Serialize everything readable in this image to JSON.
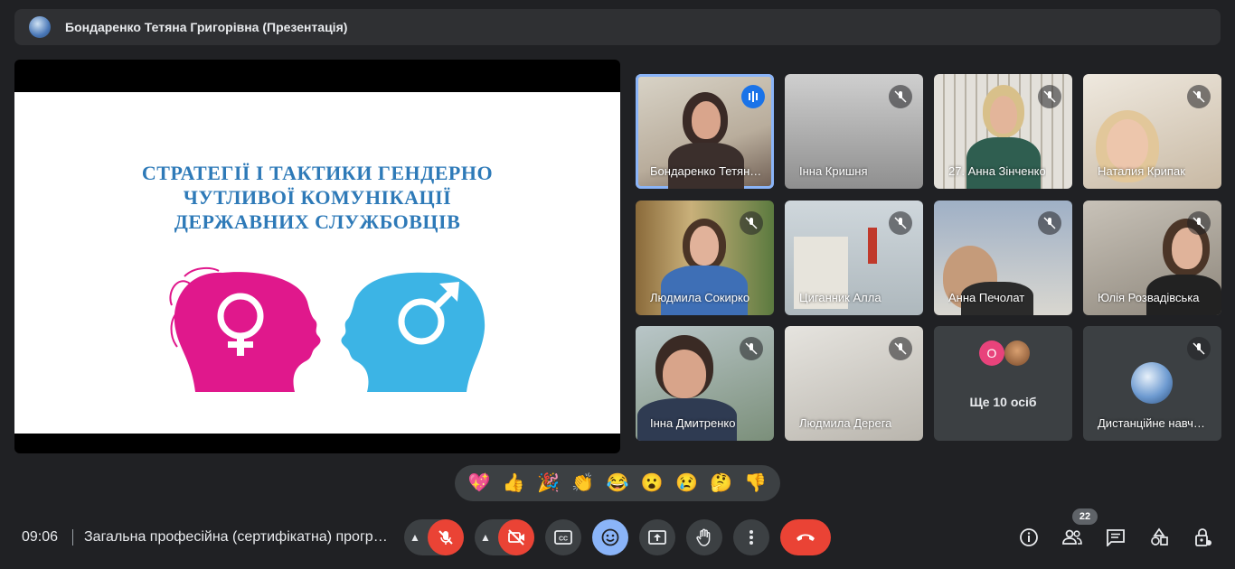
{
  "presentation": {
    "presenter_title": "Бондаренко Тетяна Григорівна (Презентація)",
    "slide": {
      "title_lines": [
        "СТРАТЕГІЇ І ТАКТИКИ ГЕНДЕРНО",
        "ЧУТЛИВОЇ КОМУНІКАЦІЇ",
        "ДЕРЖАВНИХ СЛУЖБОВЦІВ"
      ],
      "colors": {
        "title": "#2e7ab8",
        "female": "#e0188c",
        "male": "#3cb4e5"
      }
    }
  },
  "participants": [
    {
      "name": "Бондаренко Тетяна Григорівна",
      "speaking": true,
      "muted": false
    },
    {
      "name": "Інна Кришня",
      "muted": true
    },
    {
      "name": "27. Анна Зінченко",
      "muted": true
    },
    {
      "name": "Наталия Крипак",
      "muted": true
    },
    {
      "name": "Людмила Сокирко",
      "muted": true
    },
    {
      "name": "Циганник Алла",
      "muted": true
    },
    {
      "name": "Анна Печолат",
      "muted": true
    },
    {
      "name": "Юлія Розвадівська",
      "muted": true
    },
    {
      "name": "Інна Дмитренко",
      "muted": true
    },
    {
      "name": "Людмила Дерега",
      "muted": true
    },
    {
      "name": "Дистанційне навчання",
      "muted": true
    }
  ],
  "others": {
    "label": "Ще 10 осіб",
    "avatar_letter": "О"
  },
  "reactions": [
    "💖",
    "👍",
    "🎉",
    "👏",
    "😂",
    "😮",
    "😢",
    "🤔",
    "👎"
  ],
  "footer": {
    "time": "09:06",
    "meeting_name": "Загальна професійна (сертифікатна) програма",
    "participant_count": "22"
  },
  "icons": {
    "mic": "mic-off-icon",
    "camera": "camera-off-icon",
    "captions": "captions-icon",
    "emoji": "emoji-icon",
    "present": "present-screen-icon",
    "hand": "raise-hand-icon",
    "more": "more-options-icon",
    "end": "end-call-icon"
  },
  "colors": {
    "accent_red": "#ea4335",
    "accent_blue": "#8ab4f8",
    "tile_bg": "#3c4043"
  }
}
